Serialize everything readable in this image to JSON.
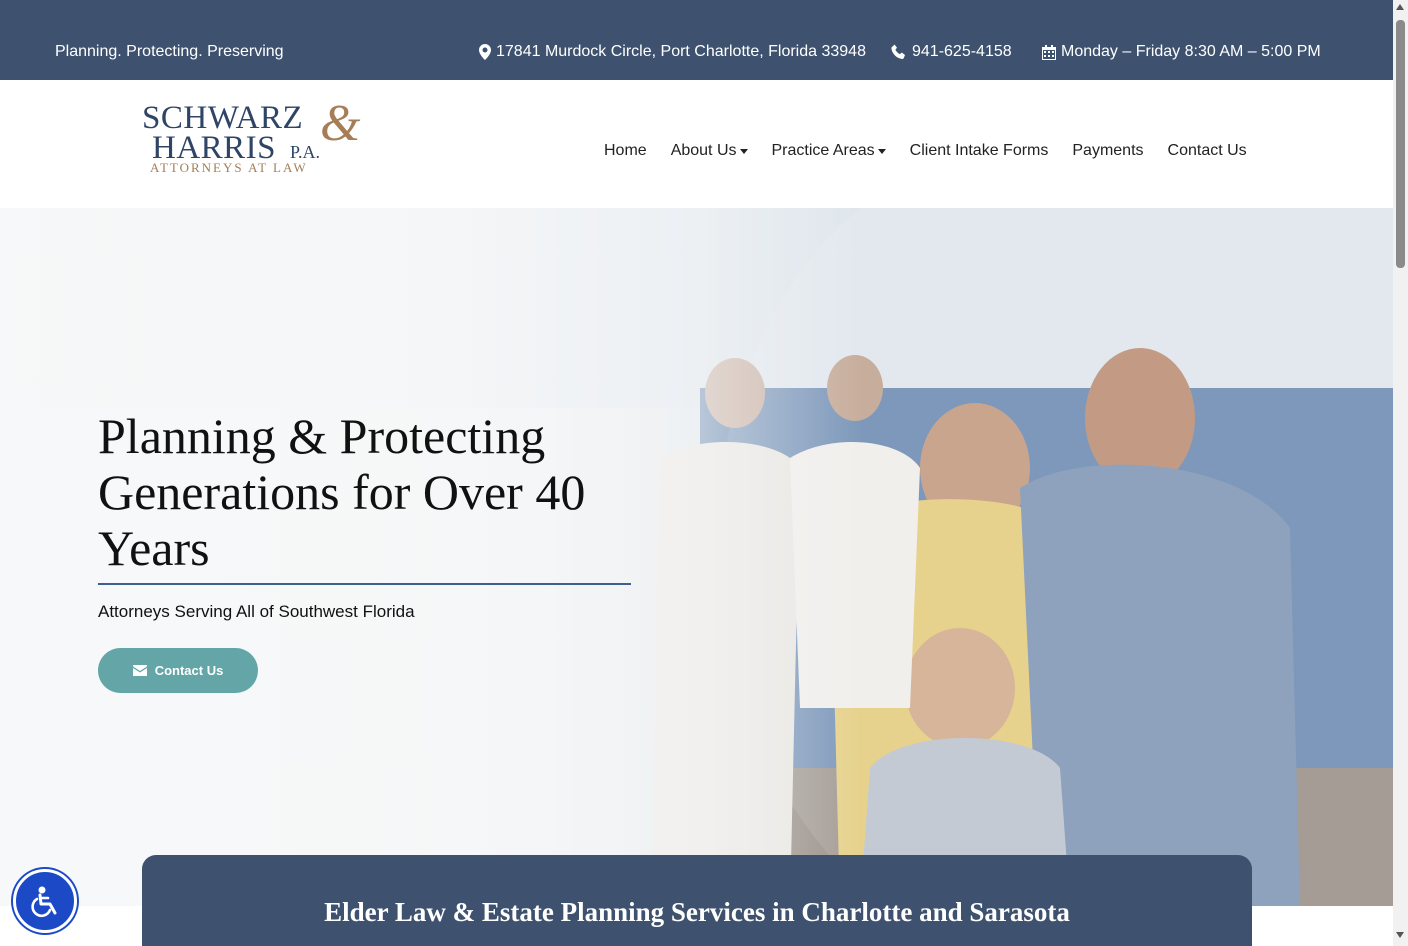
{
  "topbar": {
    "tagline": "Planning. Protecting. Preserving",
    "address": "17841 Murdock Circle, Port Charlotte, Florida 33948",
    "phone": "941-625-4158",
    "hours": "Monday – Friday 8:30 AM – 5:00 PM",
    "icons": [
      "map-marker-icon",
      "phone-icon",
      "calendar-icon"
    ]
  },
  "logo": {
    "line1": "SCHWARZ",
    "ampersand": "&",
    "line2": "HARRIS",
    "suffix": "P.A.",
    "line3": "ATTORNEYS AT LAW",
    "colors": {
      "navy": "#2f4566",
      "bronze": "#a57e57"
    }
  },
  "nav": {
    "items": [
      {
        "label": "Home",
        "dropdown": false
      },
      {
        "label": "About Us",
        "dropdown": true
      },
      {
        "label": "Practice Areas",
        "dropdown": true
      },
      {
        "label": "Client Intake Forms",
        "dropdown": false
      },
      {
        "label": "Payments",
        "dropdown": false
      },
      {
        "label": "Contact Us",
        "dropdown": false
      }
    ]
  },
  "hero": {
    "headline": "Planning & Protecting Generations for Over 40 Years",
    "subheadline": "Attorneys Serving All of Southwest Florida",
    "cta_label": "Contact Us",
    "cta_icon": "envelope-icon",
    "cta_color": "#64a6a7"
  },
  "banner": {
    "title": "Elder Law & Estate Planning Services in Charlotte and Sarasota",
    "color": "#3e526f"
  },
  "accessibility": {
    "icon": "accessibility-icon",
    "color": "#1c4ac7"
  }
}
